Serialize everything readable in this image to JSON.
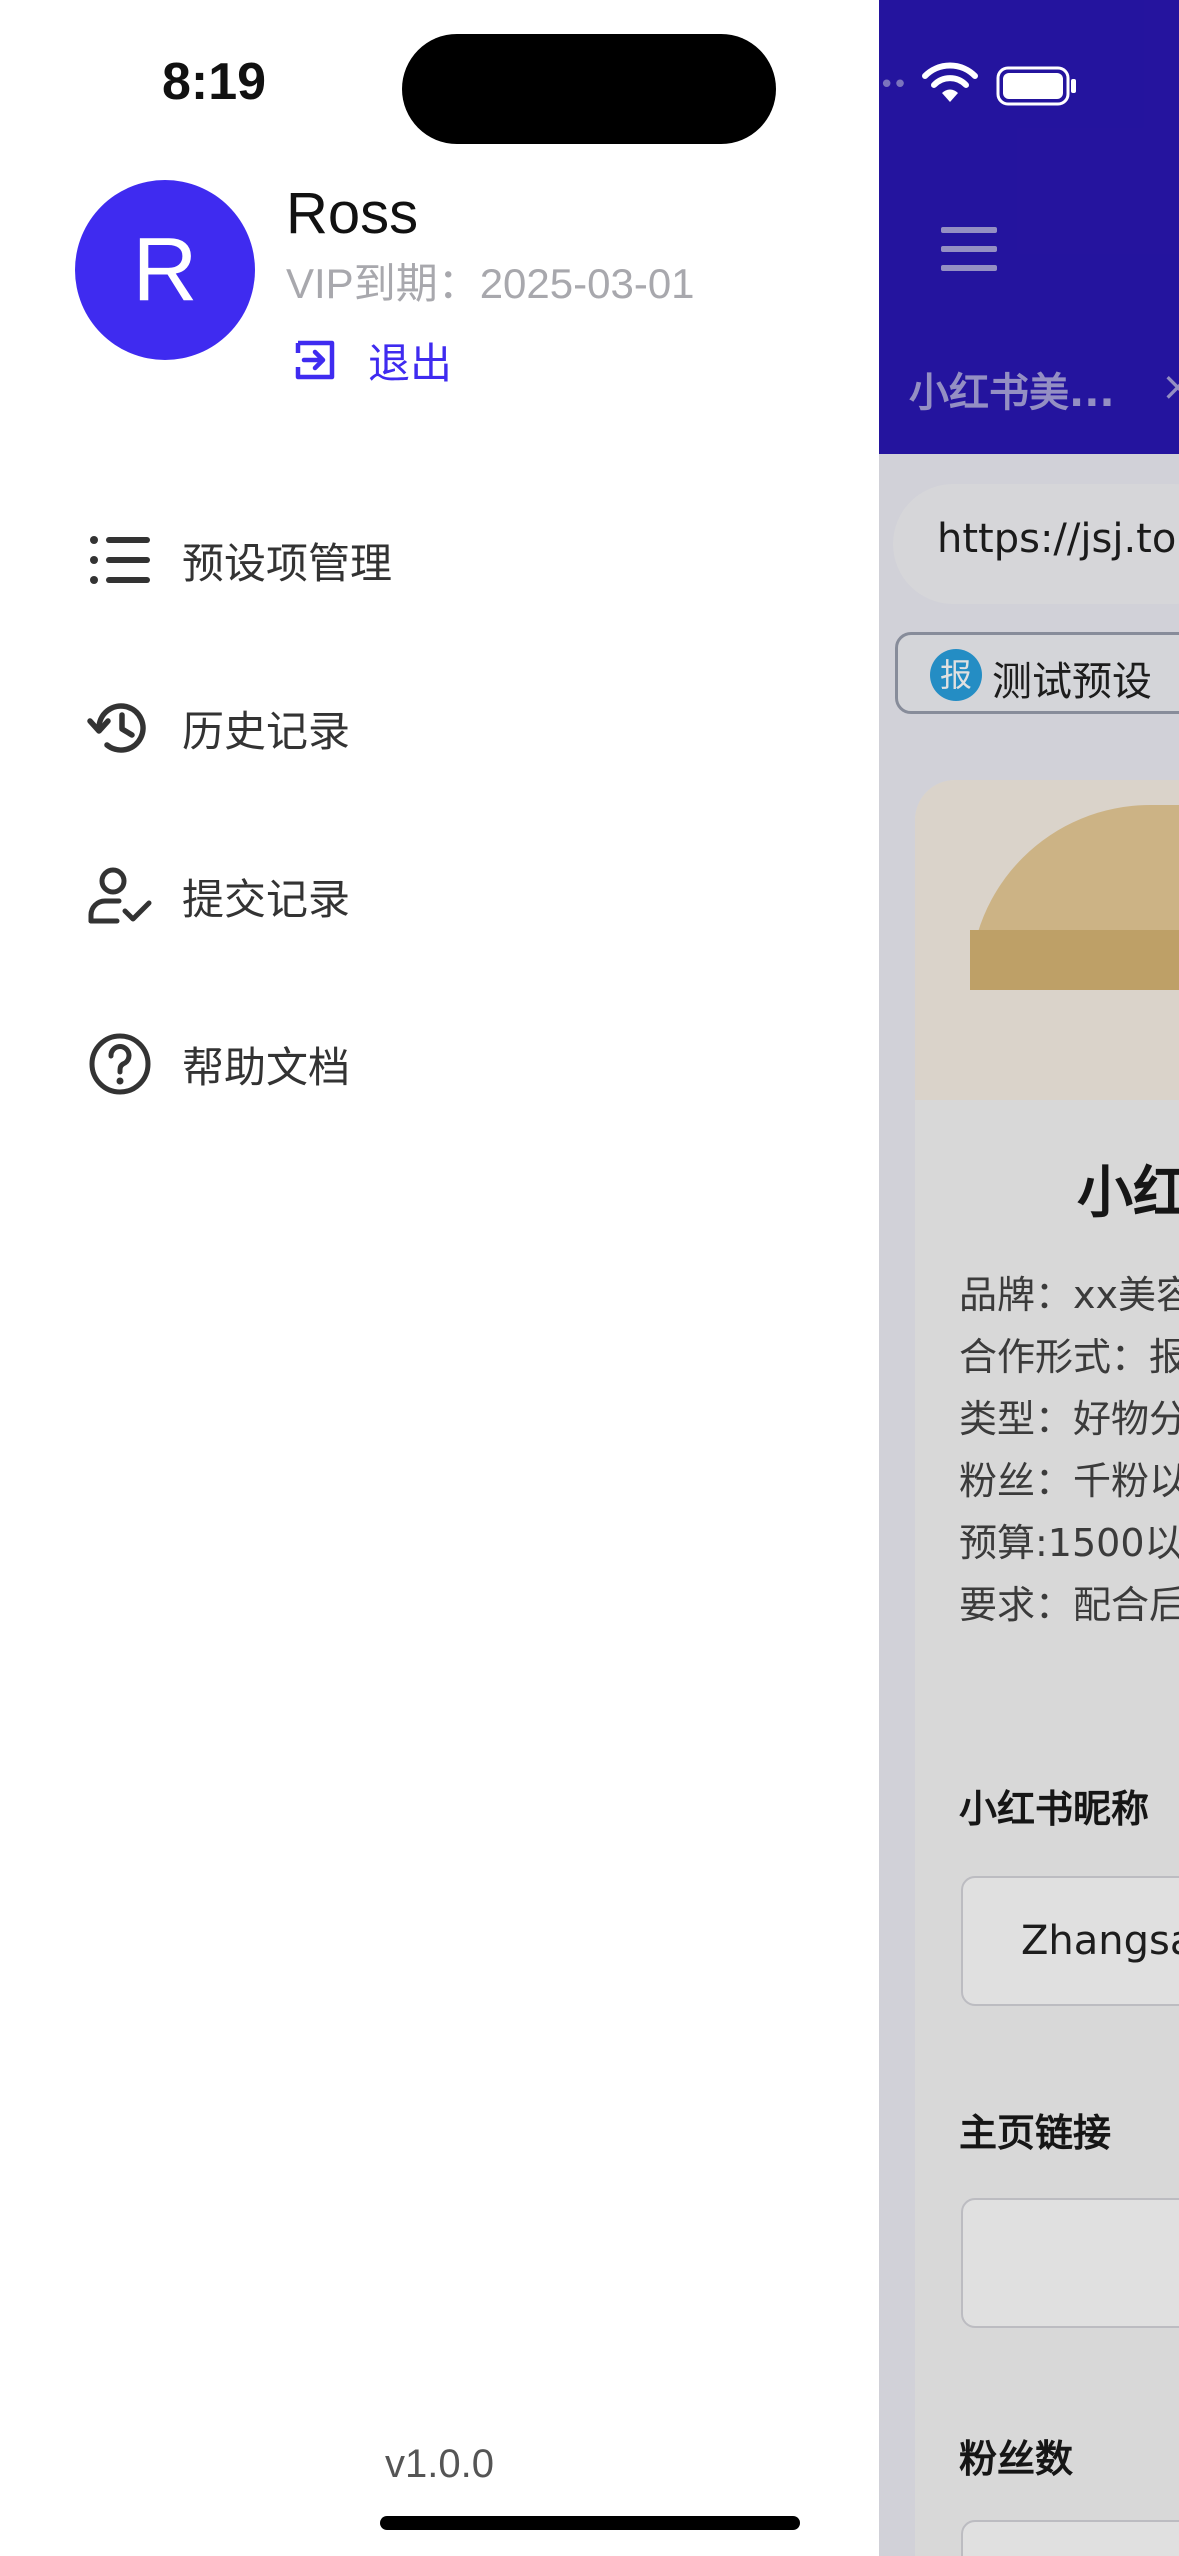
{
  "status_bar": {
    "time": "8:19"
  },
  "user": {
    "avatar_letter": "R",
    "name": "Ross",
    "vip_expiry": "VIP到期：2025-03-01",
    "logout_label": "退出"
  },
  "menu": {
    "items": [
      {
        "label": "预设项管理",
        "icon": "list-icon"
      },
      {
        "label": "历史记录",
        "icon": "history-icon"
      },
      {
        "label": "提交记录",
        "icon": "user-check-icon"
      },
      {
        "label": "帮助文档",
        "icon": "help-circle-icon"
      }
    ]
  },
  "version": "v1.0.0",
  "background_app": {
    "tab_title": "小红书美...",
    "tab_close": "×",
    "url": "https://jsj.top/",
    "preset_chip": {
      "badge": "报",
      "label": "测试预设"
    },
    "form": {
      "title": "小红",
      "info_lines": [
        "品牌：xx美容",
        "合作形式：报",
        "类型：好物分",
        "粉丝：千粉以",
        "预算:1500以",
        "要求：配合后"
      ],
      "fields": [
        {
          "label": "小红书昵称",
          "value": "Zhangsan"
        },
        {
          "label": "主页链接",
          "value": ""
        },
        {
          "label": "粉丝数",
          "value": ""
        }
      ]
    }
  },
  "colors": {
    "accent": "#3f2bf0",
    "header_bg": "#2a17b4",
    "preset_badge": "#2aa1e0"
  }
}
